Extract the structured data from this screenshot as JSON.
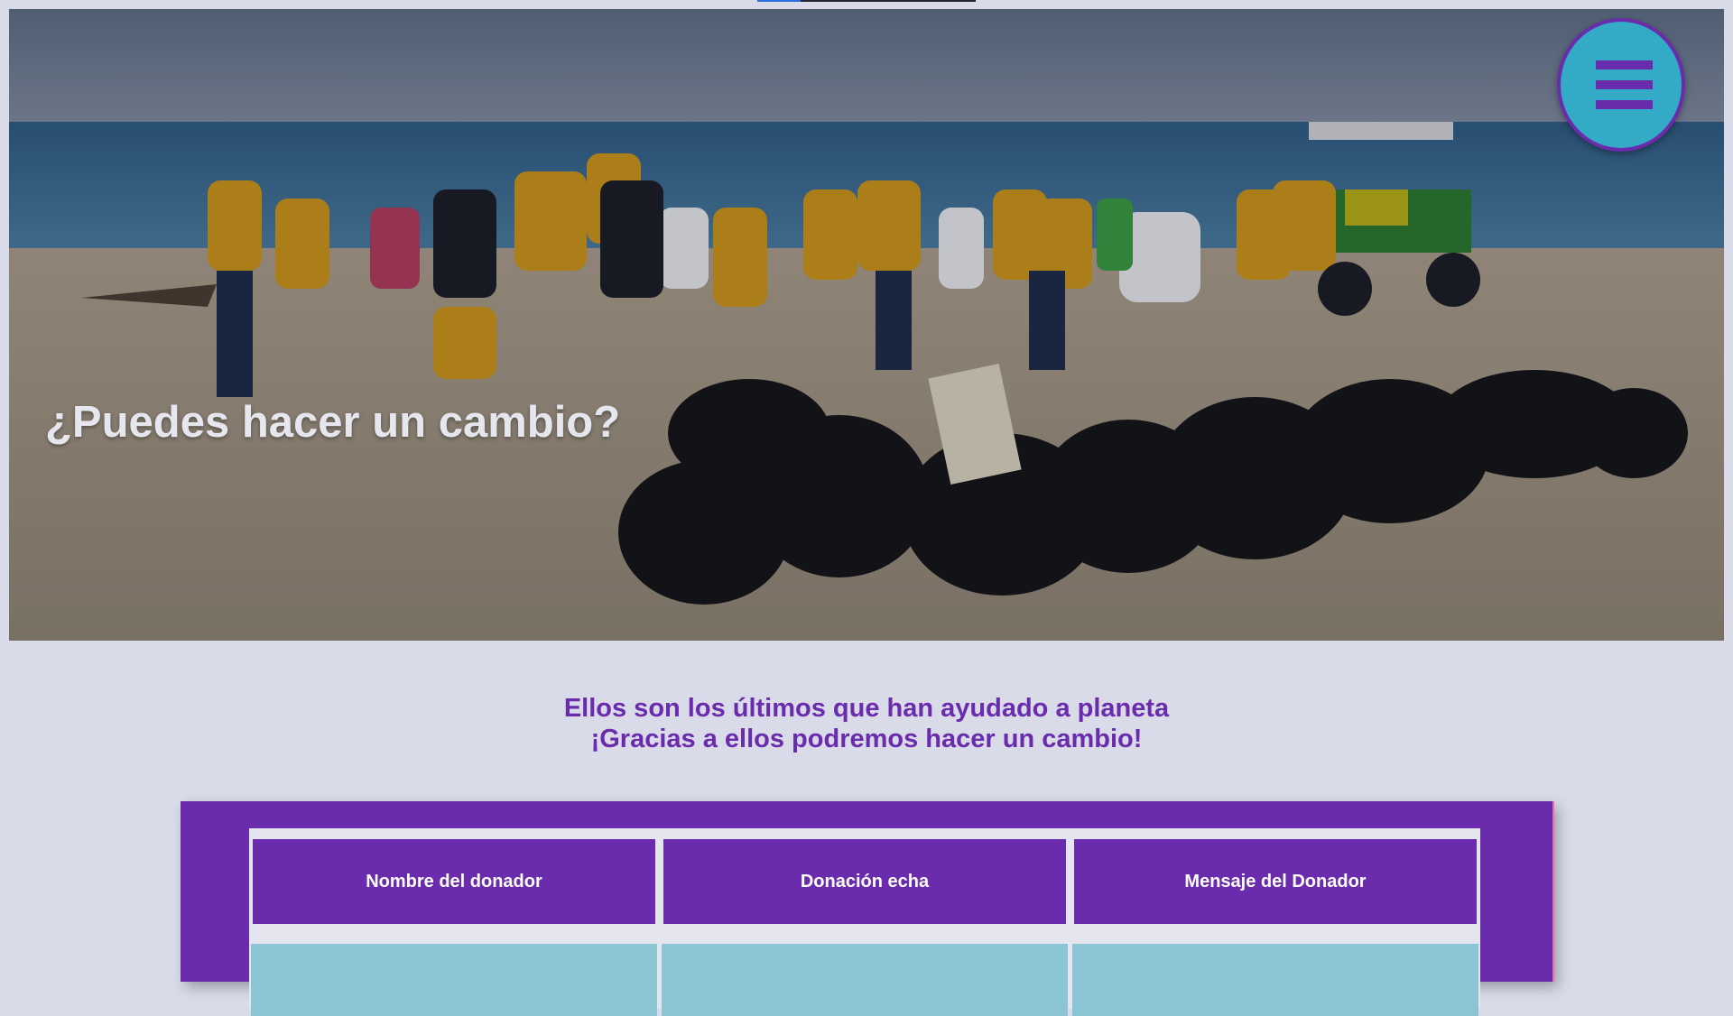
{
  "hero": {
    "title": "¿Puedes hacer un cambio?",
    "image_description_icon": "beach-cleanup-photo"
  },
  "menu": {
    "icon": "hamburger-icon",
    "color": "#33aac6",
    "accent": "#6a2bad"
  },
  "top_progress": {
    "fill_fraction": 0.2
  },
  "headline": {
    "line1": "Ellos son los últimos que han ayudado a planeta",
    "line2": "¡Gracias a ellos podremos hacer un cambio!"
  },
  "donors_table": {
    "columns": [
      "Nombre del donador",
      "Donación echa",
      "Mensaje del Donador"
    ],
    "header_color": "#6a2bad",
    "row_color": "#8bc5d3"
  }
}
